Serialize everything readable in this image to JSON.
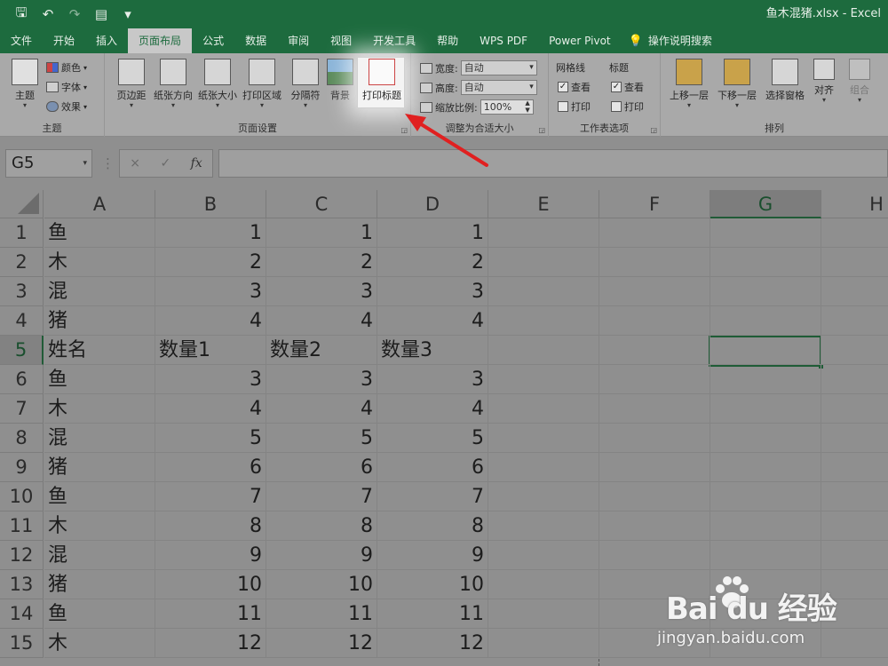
{
  "window": {
    "title": "鱼木混猪.xlsx  -  Excel"
  },
  "quick_access": {
    "icons": [
      "save-icon",
      "undo-icon",
      "redo-icon",
      "form-icon",
      "customize-icon"
    ]
  },
  "tabs": [
    "文件",
    "开始",
    "插入",
    "页面布局",
    "公式",
    "数据",
    "审阅",
    "视图",
    "开发工具",
    "帮助",
    "WPS PDF",
    "Power Pivot"
  ],
  "active_tab": "页面布局",
  "search_label": "操作说明搜索",
  "ribbon": {
    "theme": {
      "main": "主题",
      "colors": "颜色",
      "fonts": "字体",
      "effects": "效果",
      "group": "主题"
    },
    "page_setup": {
      "margins": "页边距",
      "orientation": "纸张方向",
      "size": "纸张大小",
      "print_area": "打印区域",
      "breaks": "分隔符",
      "background": "背景",
      "print_titles": "打印标题",
      "group": "页面设置"
    },
    "scale": {
      "width_label": "宽度:",
      "width_value": "自动",
      "height_label": "高度:",
      "height_value": "自动",
      "scale_label": "缩放比例:",
      "scale_value": "100%",
      "group": "调整为合适大小"
    },
    "sheet_options": {
      "gridlines": "网格线",
      "headings": "标题",
      "view": "查看",
      "print": "打印",
      "group": "工作表选项"
    },
    "arrange": {
      "bring_forward": "上移一层",
      "send_backward": "下移一层",
      "selection_pane": "选择窗格",
      "align": "对齐",
      "group_btn": "组合",
      "group": "排列"
    }
  },
  "formula_bar": {
    "name_box": "G5",
    "cancel": "×",
    "enter": "✓",
    "fx": "fx",
    "value": ""
  },
  "sheet": {
    "columns": [
      "A",
      "B",
      "C",
      "D",
      "E",
      "F",
      "G",
      "H"
    ],
    "selected_column": "G",
    "selected_row": "5",
    "rows": [
      {
        "n": "1",
        "a": "鱼",
        "b": "1",
        "c": "1",
        "d": "1"
      },
      {
        "n": "2",
        "a": "木",
        "b": "2",
        "c": "2",
        "d": "2"
      },
      {
        "n": "3",
        "a": "混",
        "b": "3",
        "c": "3",
        "d": "3"
      },
      {
        "n": "4",
        "a": "猪",
        "b": "4",
        "c": "4",
        "d": "4"
      },
      {
        "n": "5",
        "a": "姓名",
        "b": "数量1",
        "c": "数量2",
        "d": "数量3"
      },
      {
        "n": "6",
        "a": "鱼",
        "b": "3",
        "c": "3",
        "d": "3"
      },
      {
        "n": "7",
        "a": "木",
        "b": "4",
        "c": "4",
        "d": "4"
      },
      {
        "n": "8",
        "a": "混",
        "b": "5",
        "c": "5",
        "d": "5"
      },
      {
        "n": "9",
        "a": "猪",
        "b": "6",
        "c": "6",
        "d": "6"
      },
      {
        "n": "10",
        "a": "鱼",
        "b": "7",
        "c": "7",
        "d": "7"
      },
      {
        "n": "11",
        "a": "木",
        "b": "8",
        "c": "8",
        "d": "8"
      },
      {
        "n": "12",
        "a": "混",
        "b": "9",
        "c": "9",
        "d": "9"
      },
      {
        "n": "13",
        "a": "猪",
        "b": "10",
        "c": "10",
        "d": "10"
      },
      {
        "n": "14",
        "a": "鱼",
        "b": "11",
        "c": "11",
        "d": "11"
      },
      {
        "n": "15",
        "a": "木",
        "b": "12",
        "c": "12",
        "d": "12"
      }
    ]
  },
  "watermark": {
    "brand": "Bai du 经验",
    "url": "jingyan.baidu.com"
  },
  "colors": {
    "excel_green": "#1d6b3e",
    "arrow_red": "#e02020"
  }
}
